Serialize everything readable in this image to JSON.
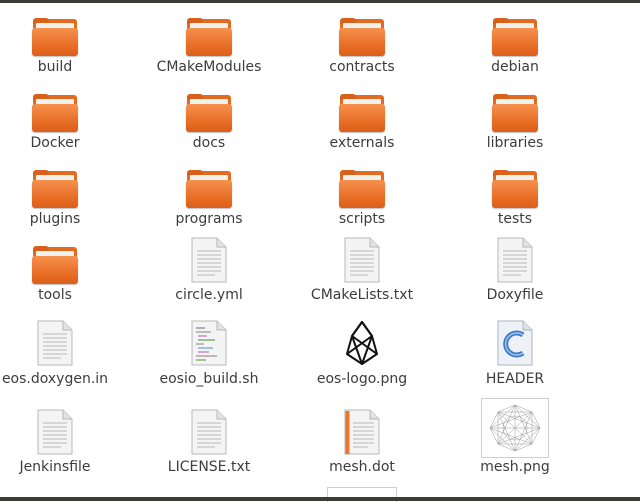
{
  "files": [
    {
      "label": "build",
      "type": "folder"
    },
    {
      "label": "CMakeModules",
      "type": "folder"
    },
    {
      "label": "contracts",
      "type": "folder"
    },
    {
      "label": "debian",
      "type": "folder"
    },
    {
      "label": "Docker",
      "type": "folder"
    },
    {
      "label": "docs",
      "type": "folder"
    },
    {
      "label": "externals",
      "type": "folder"
    },
    {
      "label": "libraries",
      "type": "folder"
    },
    {
      "label": "plugins",
      "type": "folder"
    },
    {
      "label": "programs",
      "type": "folder"
    },
    {
      "label": "scripts",
      "type": "folder"
    },
    {
      "label": "tests",
      "type": "folder"
    },
    {
      "label": "tools",
      "type": "folder"
    },
    {
      "label": "circle.yml",
      "type": "text-file"
    },
    {
      "label": "CMakeLists.txt",
      "type": "text-file"
    },
    {
      "label": "Doxyfile",
      "type": "text-file"
    },
    {
      "label": "eos.doxygen.in",
      "type": "text-file"
    },
    {
      "label": "eosio_build.sh",
      "type": "shell-script"
    },
    {
      "label": "eos-logo.png",
      "type": "image-eos-logo"
    },
    {
      "label": "HEADER",
      "type": "c-source-file"
    },
    {
      "label": "Jenkinsfile",
      "type": "text-file"
    },
    {
      "label": "LICENSE.txt",
      "type": "text-file"
    },
    {
      "label": "mesh.dot",
      "type": "dot-file"
    },
    {
      "label": "mesh.png",
      "type": "image-mesh"
    }
  ],
  "colors": {
    "folder": "#e46a1f",
    "text": "#3c3c3c",
    "chrome": "#3c3b37"
  }
}
